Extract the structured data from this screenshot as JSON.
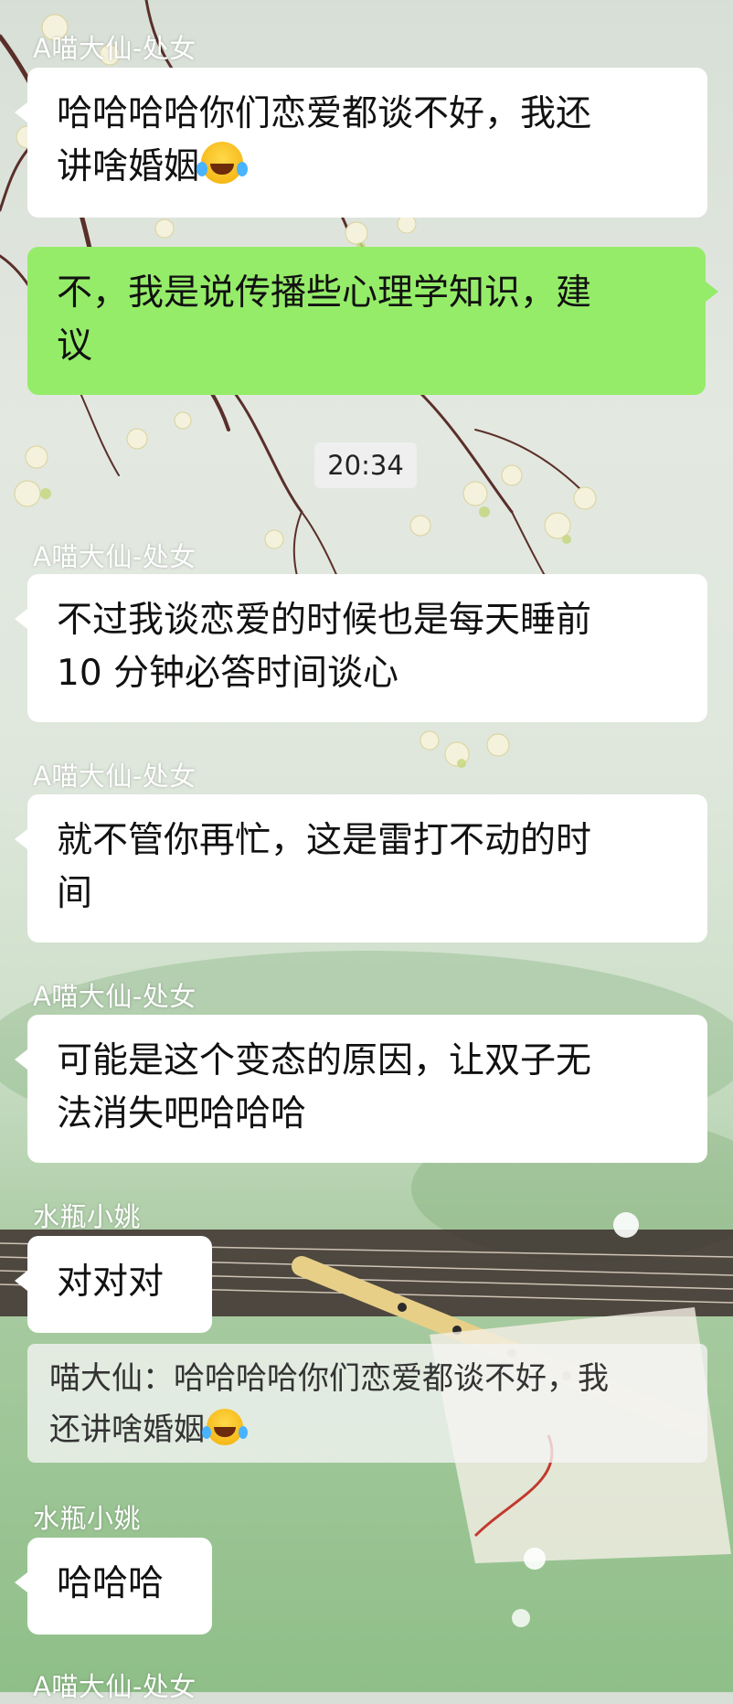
{
  "chat": {
    "messages": [
      {
        "sender": "A喵大仙-处女",
        "text_line1": "哈哈哈哈你们恋爱都谈不好，我还",
        "text_line2": "讲啥婚姻",
        "emoji": "laughing-tears-emoji"
      },
      {
        "sender": "",
        "text_line1": "不，我是说传播些心理学知识，建",
        "text_line2": "议",
        "mine": true
      },
      {
        "sender": "A喵大仙-处女",
        "text_line1": "不过我谈恋爱的时候也是每天睡前",
        "text_line2": "10 分钟必答时间谈心"
      },
      {
        "sender": "A喵大仙-处女",
        "text_line1": "就不管你再忙，这是雷打不动的时",
        "text_line2": "间"
      },
      {
        "sender": "A喵大仙-处女",
        "text_line1": "可能是这个变态的原因，让双子无",
        "text_line2": "法消失吧哈哈哈"
      },
      {
        "sender": "水瓶小姚",
        "text_line1": "对对对"
      },
      {
        "sender": "水瓶小姚",
        "text_line1": "哈哈哈"
      },
      {
        "sender": "A喵大仙-处女"
      }
    ],
    "timestamp": "20:34",
    "quote": {
      "line1": "喵大仙：哈哈哈哈你们恋爱都谈不好，我",
      "line2": "还讲啥婚姻"
    }
  },
  "colors": {
    "my_bubble": "#95ec69",
    "other_bubble": "#ffffff",
    "background": "#d7dfd6"
  }
}
